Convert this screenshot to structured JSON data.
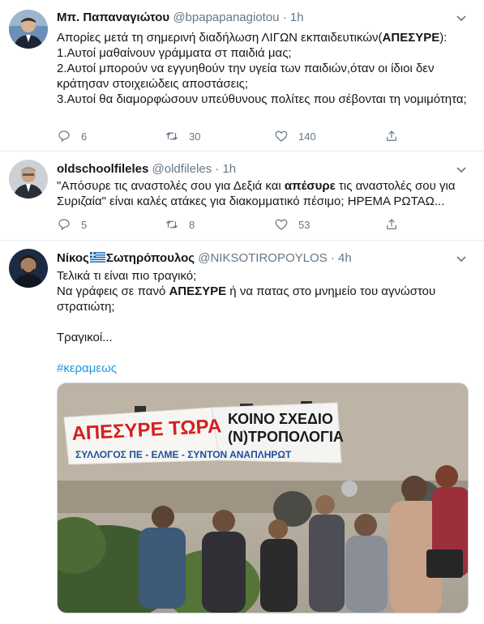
{
  "tweets": [
    {
      "name": "Μπ. Παπαναγιώτου",
      "handle": "@bpapapanagiotou",
      "dot": "·",
      "time": "1h",
      "lines": [
        "Απορίες μετά τη σημερινή διαδήλωση ΛΙΓΩΝ εκπαιδευτικών(",
        "ΑΠΕΣΥΡΕ",
        "):",
        "1.Αυτοί μαθαίνουν γράμματα στ παιδιά μας;",
        "2.Αυτοί μπορούν να εγγυηθούν την υγεία των παιδιών,όταν οι ίδιοι δεν κράτησαν στοιχειώδεις αποστάσεις;",
        "3.Αυτοί θα διαμορφώσουν υπεύθυνους πολίτες που σέβονται τη νομιμότητα;"
      ],
      "replies": "6",
      "retweets": "30",
      "likes": "140"
    },
    {
      "name": "oldschoolfileles",
      "handle": "@oldfileles",
      "dot": "·",
      "time": "1h",
      "text_a": "\"Απόσυρε τις αναστολές σου για Δεξιά και ",
      "text_b": "απέσυρε",
      "text_c": " τις αναστολές σου για Συριζαία\" είναι καλές ατάκες για διακομματικό πέσιμο; ΗΡΕΜΑ ΡΩΤΑΩ...",
      "replies": "5",
      "retweets": "8",
      "likes": "53"
    },
    {
      "name_a": "Νίκος",
      "name_b": "Σωτηρόπουλος",
      "handle": "@NIKSOTIROPOYLOS",
      "dot": "·",
      "time": "4h",
      "line1": "Τελικά τι είναι πιο τραγικό;",
      "line2_a": "Να γράφεις σε πανό ",
      "line2_b": "ΑΠΕΣΥΡΕ",
      "line2_c": " ή να πατας στο μνημείο του αγνώστου στρατιώτη;",
      "line3": "Τραγικοί...",
      "hashtag": "#κεραμεως",
      "banner_left": "ΑΠΕΣΥΡΕ ΤΩΡΑ",
      "banner_right_1": "ΚΟΙΝΟ ΣΧΕΔΙΟ",
      "banner_right_2": "(Ν)ΤΡΟΠΟΛΟΓΙΑ",
      "banner_bottom": "ΣΥΛΛΟΓΟΣ ΠΕ - ΕΛΜΕ - ΣΥΝΤΟΝ ΑΝΑΠΛΗΡΩΤ"
    }
  ],
  "colors": {
    "text": "#14171a",
    "muted": "#657786",
    "link": "#1b95e0",
    "border": "#e6ecf0"
  },
  "icons": [
    "reply-icon",
    "retweet-icon",
    "like-icon",
    "share-icon",
    "caret-down-icon",
    "greek-flag-icon"
  ]
}
